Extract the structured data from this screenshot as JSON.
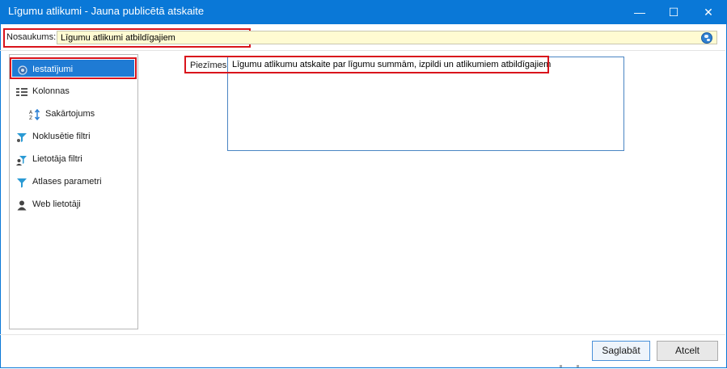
{
  "window": {
    "title": "Līgumu atlikumi - Jauna publicētā atskaite",
    "minimize_glyph": "—",
    "maximize_glyph": "☐",
    "close_glyph": "✕",
    "accent_color": "#0a78d7"
  },
  "name_field": {
    "label": "Nosaukums:",
    "value": "Līgumu atlikumi atbildīgajiem",
    "icon": "globe-icon"
  },
  "sidebar": {
    "items": [
      {
        "label": "Iestatījumi",
        "icon": "settings-gear-icon",
        "selected": true
      },
      {
        "label": "Kolonnas",
        "icon": "columns-list-icon"
      },
      {
        "label": "Sakārtojums",
        "icon": "sort-az-icon",
        "indent": true
      },
      {
        "label": "Noklusētie filtri",
        "icon": "default-filter-icon"
      },
      {
        "label": "Lietotāja filtri",
        "icon": "user-filter-icon"
      },
      {
        "label": "Atlases parametri",
        "icon": "selection-filter-icon"
      },
      {
        "label": "Web lietotāji",
        "icon": "web-user-icon"
      }
    ]
  },
  "notes": {
    "label": "Piezīmes:",
    "value": "Līgumu atlikumu atskaite par līgumu summām, izpildi un atlikumiem atbildīgajiem"
  },
  "footer": {
    "save_label": "Saglabāt",
    "cancel_label": "Atcelt"
  },
  "colors": {
    "selection": "#1f7bd4",
    "highlight_frame": "#d9141c",
    "input_bg": "#fffbd2"
  }
}
